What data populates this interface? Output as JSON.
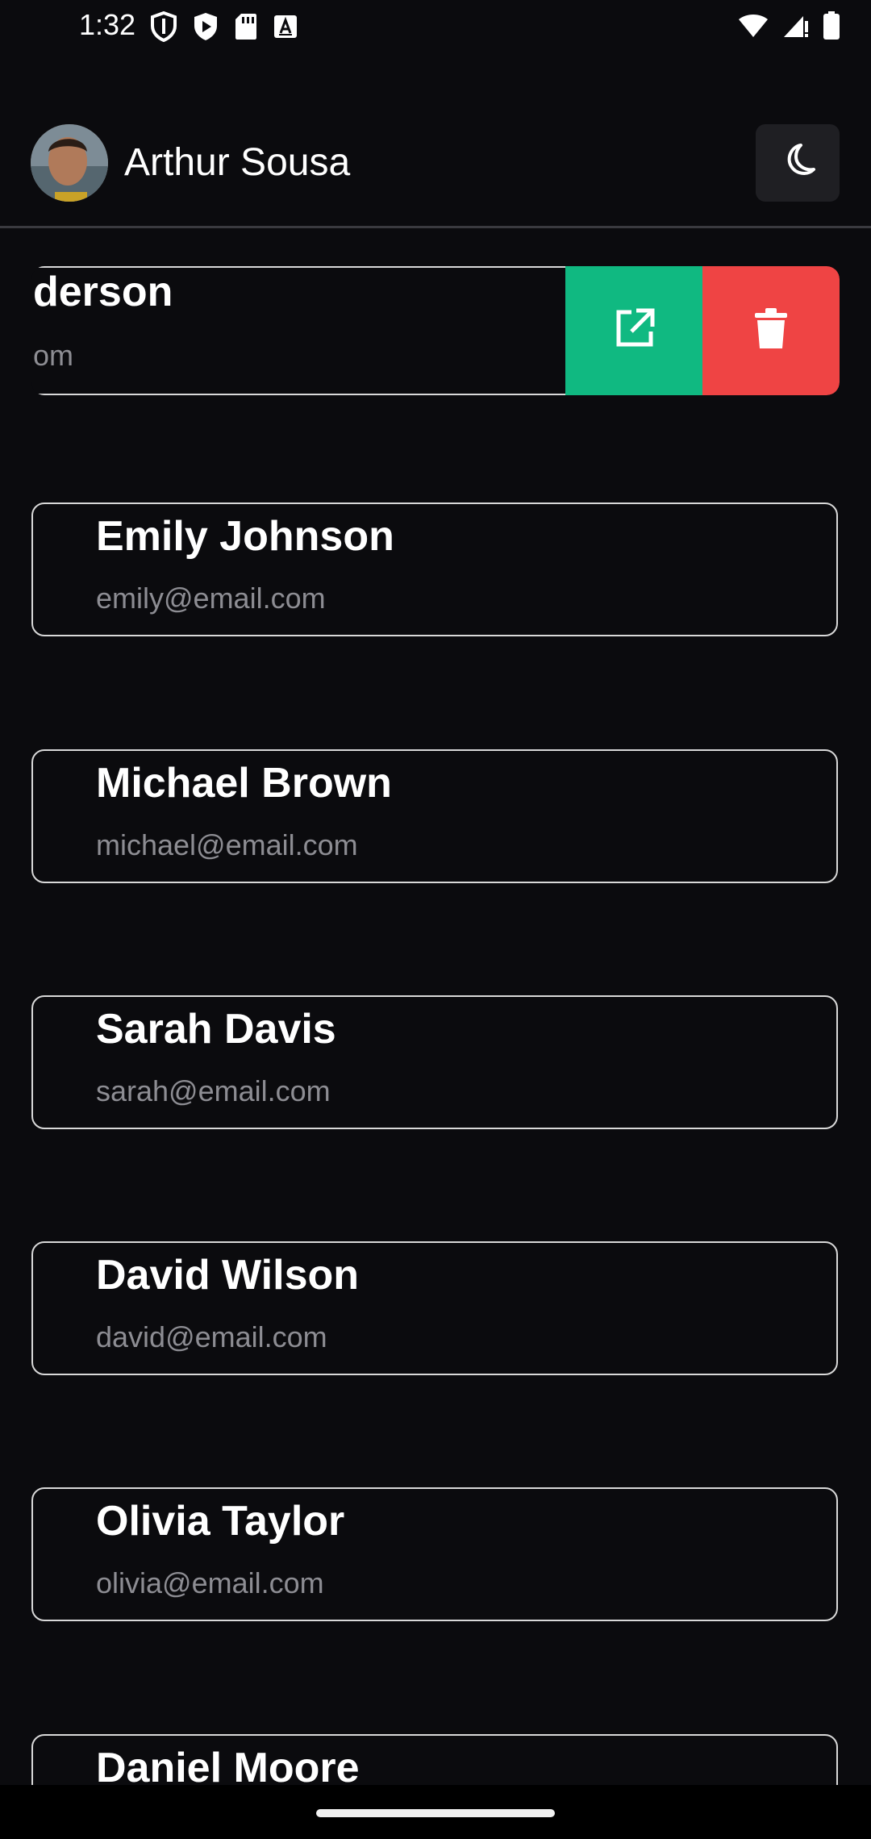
{
  "status_bar": {
    "time": "1:32",
    "left_icons": [
      "shield-icon",
      "play-protect-icon",
      "sd-card-icon",
      "font-a-icon"
    ],
    "right_icons": [
      "wifi-icon",
      "cell-signal-icon",
      "battery-icon"
    ]
  },
  "header": {
    "user_name": "Arthur Sousa",
    "avatar": "user-avatar",
    "theme_toggle_icon": "moon-icon"
  },
  "colors": {
    "background": "#0b0b0e",
    "card_border": "#d9d9d9",
    "edit_action": "#10b981",
    "delete_action": "#ef4444",
    "email_text": "#8d8d93"
  },
  "swiped_item": {
    "name": "derson",
    "email": "om",
    "actions": {
      "edit_icon": "external-link-icon",
      "delete_icon": "trash-icon"
    }
  },
  "contacts": [
    {
      "name": "Emily Johnson",
      "email": "emily@email.com"
    },
    {
      "name": "Michael Brown",
      "email": "michael@email.com"
    },
    {
      "name": "Sarah Davis",
      "email": "sarah@email.com"
    },
    {
      "name": "David Wilson",
      "email": "david@email.com"
    },
    {
      "name": "Olivia Taylor",
      "email": "olivia@email.com"
    },
    {
      "name": "Daniel Moore",
      "email": ""
    }
  ]
}
